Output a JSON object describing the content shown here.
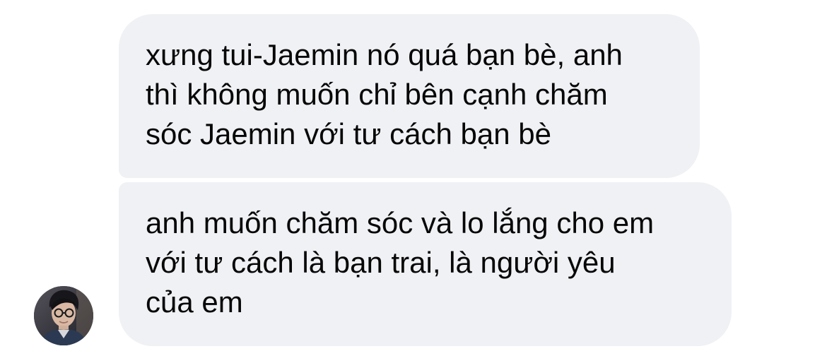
{
  "messages": [
    {
      "sender": "other",
      "lines": [
        "xưng tui-Jaemin nó quá bạn bè, anh",
        "thì không muốn chỉ bên cạnh chăm",
        "sóc Jaemin với tư cách bạn bè"
      ]
    },
    {
      "sender": "other",
      "lines": [
        "anh muốn chăm sóc và lo lắng cho em",
        "với tư cách là bạn trai, là người yêu",
        "của em"
      ]
    }
  ],
  "colors": {
    "background": "#ffffff",
    "bubble": "#f0f1f4",
    "text": "#070707"
  },
  "avatar": {
    "icon": "person-with-glasses-photo"
  }
}
